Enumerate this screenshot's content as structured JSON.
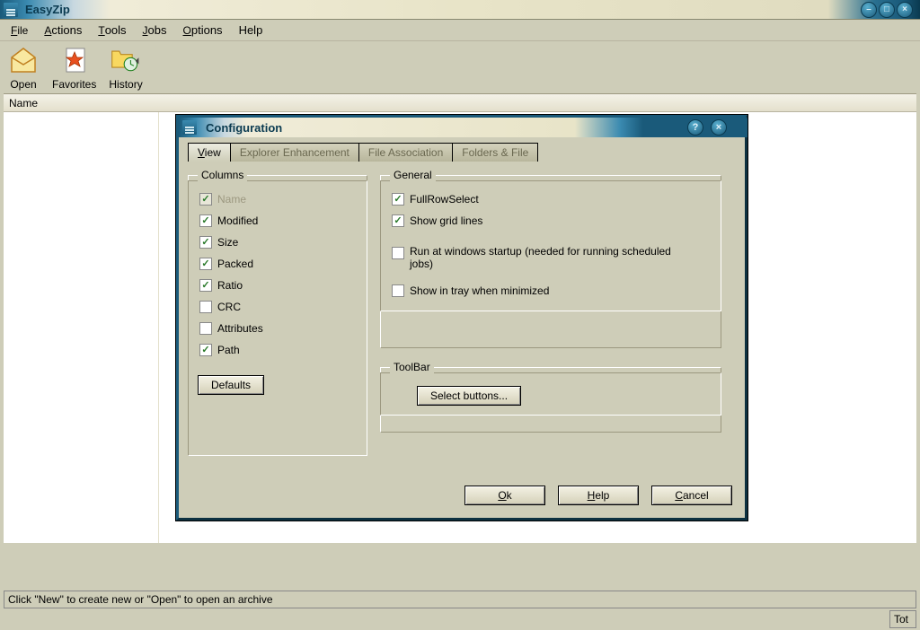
{
  "window": {
    "title": "EasyZip"
  },
  "menubar": {
    "file": "File",
    "actions": "Actions",
    "tools": "Tools",
    "jobs": "Jobs",
    "options": "Options",
    "help": "Help"
  },
  "toolbar": {
    "open": "Open",
    "favorites": "Favorites",
    "history": "History"
  },
  "list": {
    "header_name": "Name"
  },
  "statusbar": {
    "message": "Click \"New\" to create new or \"Open\" to open an archive",
    "right": "Tot"
  },
  "dialog": {
    "title": "Configuration",
    "tabs": {
      "view": "View",
      "explorer": "Explorer Enhancement",
      "fileassoc": "File Association",
      "folders": "Folders & File"
    },
    "groups": {
      "columns": "Columns",
      "general": "General",
      "toolbar": "ToolBar"
    },
    "columns": {
      "name": "Name",
      "modified": "Modified",
      "size": "Size",
      "packed": "Packed",
      "ratio": "Ratio",
      "crc": "CRC",
      "attributes": "Attributes",
      "path": "Path"
    },
    "general": {
      "fullrow": "FullRowSelect",
      "gridlines": "Show grid lines",
      "runstartup": "Run at windows startup (needed for running scheduled jobs)",
      "tray": "Show in tray when minimized"
    },
    "buttons": {
      "defaults": "Defaults",
      "selectbuttons": "Select buttons...",
      "ok": "Ok",
      "help": "Help",
      "cancel": "Cancel"
    }
  }
}
